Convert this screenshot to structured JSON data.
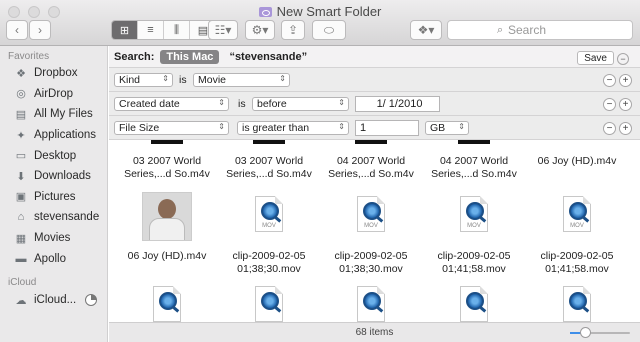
{
  "window": {
    "title": "New Smart Folder"
  },
  "toolbar": {
    "search_placeholder": "Search",
    "back_icon": "chevron-left-icon",
    "forward_icon": "chevron-right-icon"
  },
  "sidebar": {
    "favorites_heading": "Favorites",
    "items": [
      {
        "label": "Dropbox",
        "icon": "dropbox-icon"
      },
      {
        "label": "AirDrop",
        "icon": "airdrop-icon"
      },
      {
        "label": "All My Files",
        "icon": "all-files-icon"
      },
      {
        "label": "Applications",
        "icon": "applications-icon"
      },
      {
        "label": "Desktop",
        "icon": "desktop-icon"
      },
      {
        "label": "Downloads",
        "icon": "downloads-icon"
      },
      {
        "label": "Pictures",
        "icon": "pictures-icon"
      },
      {
        "label": "stevensande",
        "icon": "home-icon"
      },
      {
        "label": "Movies",
        "icon": "movies-icon"
      },
      {
        "label": "Apollo",
        "icon": "drive-icon"
      }
    ],
    "icloud_heading": "iCloud",
    "icloud_items": [
      {
        "label": "iCloud...",
        "icon": "icloud-icon"
      }
    ]
  },
  "search_bar": {
    "label": "Search:",
    "scope_active": "This Mac",
    "scope_user": "“stevensande”",
    "save_label": "Save"
  },
  "criteria": [
    {
      "attribute": "Kind",
      "operator": "is",
      "value": "Movie"
    },
    {
      "attribute": "Created date",
      "operator": "is",
      "comparison": "before",
      "value": "1/  1/2010"
    },
    {
      "attribute": "File Size",
      "comparison": "is greater than",
      "value": "1",
      "unit": "GB"
    }
  ],
  "files_top_row": [
    {
      "line1": "03 2007 World",
      "line2": "Series,...d So.m4v"
    },
    {
      "line1": "03 2007 World",
      "line2": "Series,...d So.m4v"
    },
    {
      "line1": "04 2007 World",
      "line2": "Series,...d So.m4v"
    },
    {
      "line1": "04 2007 World",
      "line2": "Series,...d So.m4v"
    },
    {
      "line1": "06 Joy (HD).m4v",
      "line2": ""
    }
  ],
  "files_mid_row": [
    {
      "line1": "06 Joy (HD).m4v",
      "line2": "",
      "type": "thumbnail"
    },
    {
      "line1": "clip-2009-02-05",
      "line2": "01;38;30.mov",
      "type": "mov"
    },
    {
      "line1": "clip-2009-02-05",
      "line2": "01;38;30.mov",
      "type": "mov"
    },
    {
      "line1": "clip-2009-02-05",
      "line2": "01;41;58.mov",
      "type": "mov"
    },
    {
      "line1": "clip-2009-02-05",
      "line2": "01;41;58.mov",
      "type": "mov"
    }
  ],
  "mov_badge": "MOV",
  "status": {
    "item_count": "68 items",
    "zoom_level": 0.25
  },
  "colors": {
    "accent": "#3e8ee9",
    "pill": "#858486"
  }
}
